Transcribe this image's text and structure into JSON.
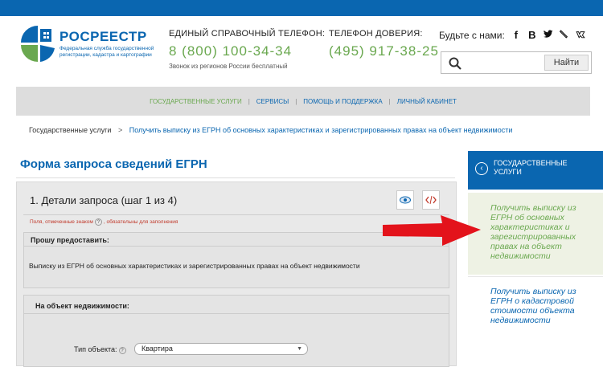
{
  "header": {
    "logo_title": "РОСРЕЕСТР",
    "logo_subtitle": "Федеральная служба государственной регистрации, кадастра и картографии",
    "phone_label": "ЕДИНЫЙ СПРАВОЧНЫЙ ТЕЛЕФОН:",
    "phone_number": "8 (800) 100-34-34",
    "phone_note": "Звонок из регионов России бесплатный",
    "trust_label": "ТЕЛЕФОН ДОВЕРИЯ:",
    "trust_number": "(495) 917-38-25",
    "social_label": "Будьте с нами:",
    "social_icons": [
      "facebook-icon",
      "blog-icon",
      "twitter-icon",
      "livejournal-icon",
      "vk-icon"
    ],
    "search_button": "Найти"
  },
  "nav": {
    "items": [
      "ГОСУДАРСТВЕННЫЕ УСЛУГИ",
      "СЕРВИСЫ",
      "ПОМОЩЬ И ПОДДЕРЖКА",
      "ЛИЧНЫЙ КАБИНЕТ"
    ],
    "separator": "|"
  },
  "breadcrumb": {
    "root": "Государственные услуги",
    "arrow": ">",
    "current": "Получить выписку из ЕГРН об основных характеристиках и зарегистрированных правах на объект недвижимости"
  },
  "form": {
    "title": "Форма запроса сведений ЕГРН",
    "step_title": "1. Детали запроса (шаг 1 из 4)",
    "required_note_prefix": "Поля, отмеченные знаком",
    "required_note_suffix": ", обязательны для заполнения",
    "request_label": "Прошу предоставить:",
    "request_value": "Выписку из ЕГРН об основных характеристиках и зарегистрированных правах на объект недвижимости",
    "object_label": "На объект недвижимости:",
    "type_label": "Тип объекта:",
    "type_value": "Квартира",
    "help_glyph": "?"
  },
  "sidebar": {
    "header": "ГОСУДАРСТВЕННЫЕ УСЛУГИ",
    "back_glyph": "‹",
    "items": [
      "Получить выписку из ЕГРН об основных характеристиках и зарегистрированных правах на объект недвижимости",
      "Получить выписку из ЕГРН о кадастровой стоимости объекта недвижимости"
    ]
  },
  "colors": {
    "brand_blue": "#0a66b0",
    "accent_green": "#6aa84f",
    "arrow_red": "#e3131b"
  }
}
